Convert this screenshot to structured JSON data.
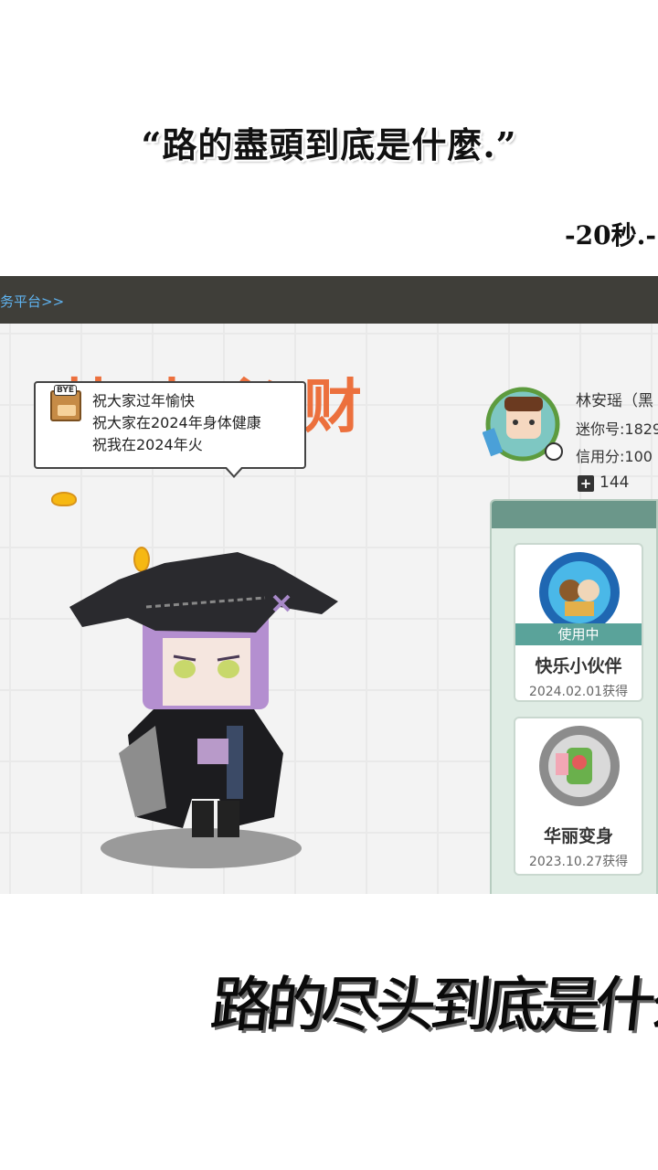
{
  "header": {
    "quote": "“路的盡頭到底是什麼.”",
    "duration": "-20秒.-"
  },
  "game": {
    "topbar_link": "务平台>>",
    "background_title": "快来必财",
    "speech_bubble": {
      "icon_label": "BYE",
      "lines": [
        "祝大家过年愉快",
        "祝大家在2024年身体健康",
        "祝我在2024年火"
      ]
    },
    "profile": {
      "name": "林安瑶（黑",
      "mini_id": "迷你号:1829",
      "credit": "信用分:100",
      "count": "144"
    },
    "cards": [
      {
        "status": "使用中",
        "title": "快乐小伙伴",
        "date": "2024.02.01获得"
      },
      {
        "title": "华丽变身",
        "date": "2023.10.27获得"
      }
    ]
  },
  "caption": "路的尽头到底是什么",
  "colors": {
    "topbar": "#3f3e39",
    "link": "#5fb3f0",
    "bg_title": "#ec6a34",
    "in_use": "#5aa39a",
    "panel": "#dfece4"
  }
}
